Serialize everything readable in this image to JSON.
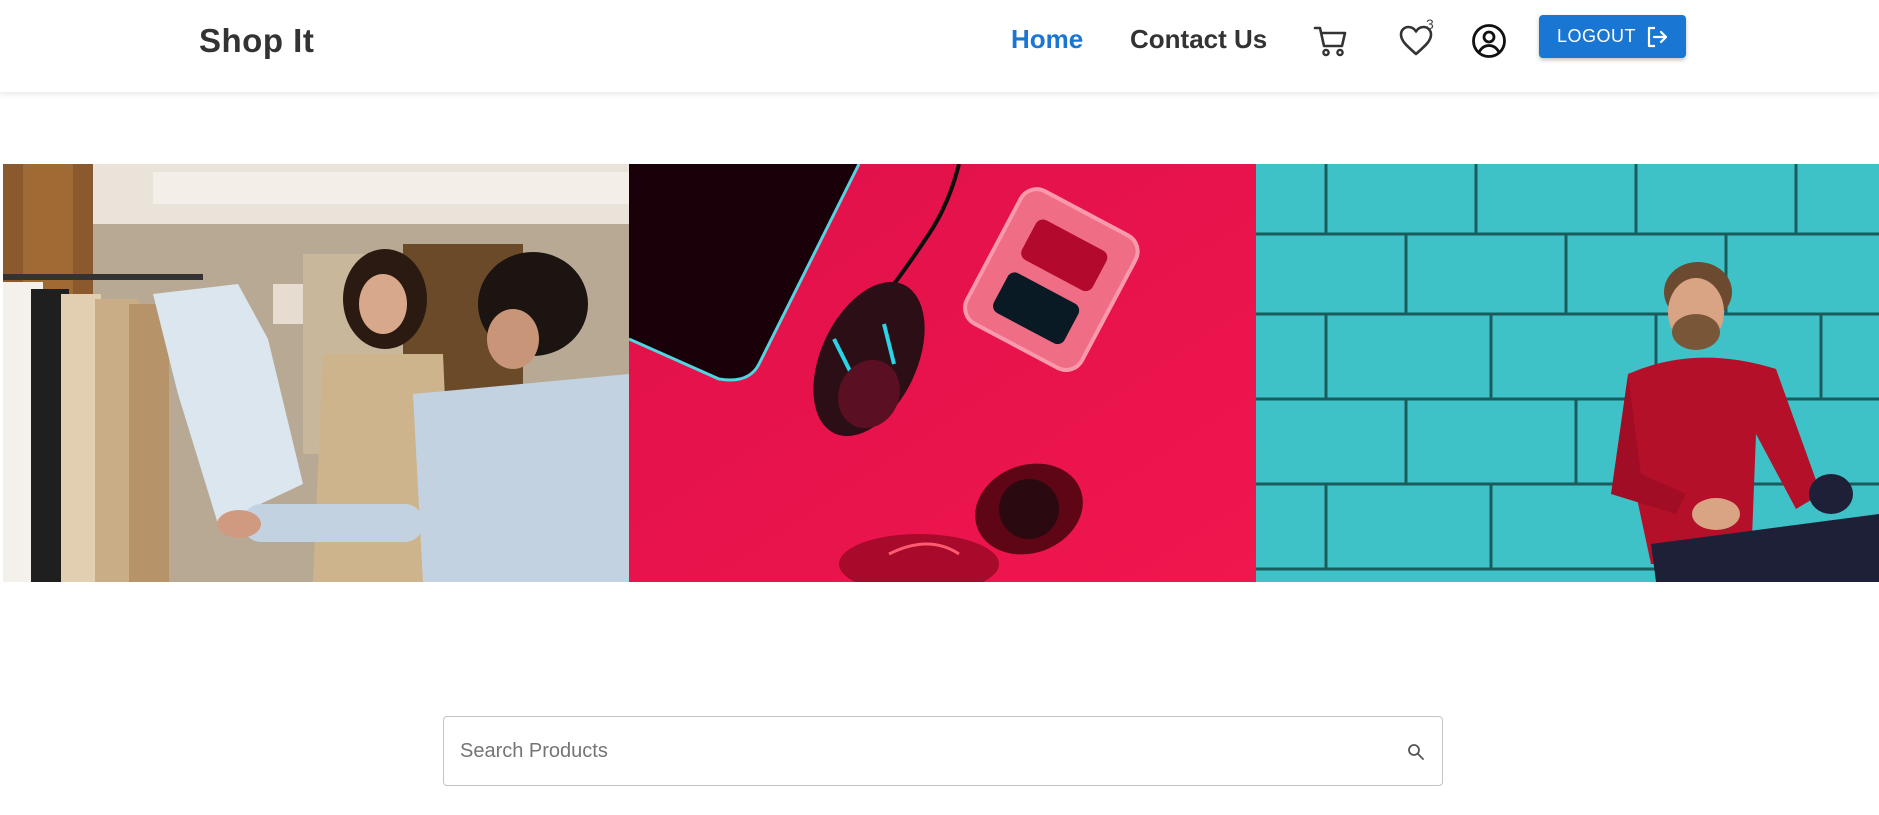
{
  "brand": {
    "name": "Shop It"
  },
  "nav": {
    "home_label": "Home",
    "contact_label": "Contact Us"
  },
  "icons": {
    "cart": "cart-icon",
    "wishlist": "heart-icon",
    "account": "account-circle-icon",
    "logout": "logout-icon",
    "search": "search-icon"
  },
  "wishlist": {
    "count": "3"
  },
  "logout": {
    "label": "LOGOUT"
  },
  "banner": {
    "slides": [
      "clothing-store-shoppers",
      "neon-gaming-mouse-and-glasses",
      "man-in-red-sweater-by-teal-wall"
    ]
  },
  "search": {
    "placeholder": "Search Products",
    "value": ""
  },
  "colors": {
    "accent": "#1976d2",
    "text": "#333333",
    "nav_active": "#1976d2"
  }
}
